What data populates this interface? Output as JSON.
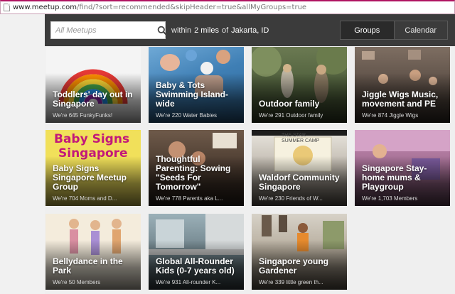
{
  "browser": {
    "url_host": "www.meetup.com",
    "url_path": "/find/?sort=recommended&skipHeader=true&allMyGroups=true"
  },
  "search": {
    "placeholder": "All Meetups",
    "within_label": "within",
    "radius": "2 miles",
    "of_label": "of",
    "location": "Jakarta, ID"
  },
  "view_toggle": {
    "groups_label": "Groups",
    "calendar_label": "Calendar"
  },
  "groups": [
    {
      "title": "Toddlers' day out in Singapore",
      "meta": "We're 645 FunkyFunks!"
    },
    {
      "title": "Baby & Tots Swimming Island-wide",
      "meta": "We're 220 Water Babies"
    },
    {
      "title": "Outdoor family",
      "meta": "We're 291 Outdoor family"
    },
    {
      "title": "Jiggle Wigs Music, movement and PE",
      "meta": "We're 874 Jiggle Wigs"
    },
    {
      "title": "Baby Signs Singapore Meetup Group",
      "meta": "We're 704 Moms and D..."
    },
    {
      "title": "Thoughtful Parenting: Sowing \"Seeds For Tomorrow\"",
      "meta": "We're 778 Parents aka L..."
    },
    {
      "title": "Waldorf Community Singapore",
      "meta": "We're 230 Friends of W..."
    },
    {
      "title": "Singapore Stay-home mums & Playgroup",
      "meta": "We're 1,703 Members"
    },
    {
      "title": "Bellydance in the Park",
      "meta": "We're 50 Members"
    },
    {
      "title": "Global All-Rounder Kids (0-7 years old)",
      "meta": "We're 931 All-rounder K..."
    },
    {
      "title": "Singapore young Gardener",
      "meta": "We're 339 little green th..."
    }
  ],
  "image_text": {
    "baby_signs_line1": "Baby Signs",
    "baby_signs_line2": "Singapore",
    "camp_line1": "THE STAR",
    "camp_line2": "SUMMER CAMP"
  },
  "colors": {
    "topbar": "#3b3b3b",
    "address_accent": "#b01561",
    "background": "#efefef"
  }
}
